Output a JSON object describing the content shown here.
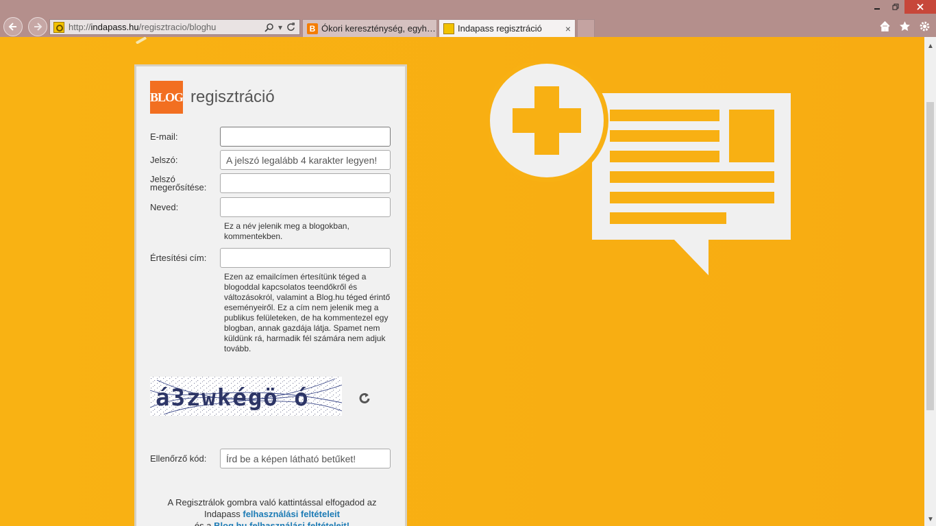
{
  "browser": {
    "url_proto": "http://",
    "url_host": "indapass.hu",
    "url_path": "/regisztracio/bloghu",
    "tabs": [
      {
        "label": "Ókori kereszténység, egyházat..."
      },
      {
        "label": "Indapass regisztráció",
        "close": "×"
      }
    ]
  },
  "form": {
    "logo_text": "BLOG",
    "title": "regisztráció",
    "email_label": "E-mail:",
    "email_value": "",
    "password_label": "Jelszó:",
    "password_placeholder": "A jelszó legalább 4 karakter legyen!",
    "password_confirm_label": "Jelszó megerősítése:",
    "name_label": "Neved:",
    "name_help": "Ez a név jelenik meg a blogokban, kommentekben.",
    "notify_label": "Értesítési cím:",
    "notify_help": "Ezen az emailcímen értesítünk téged a blogoddal kapcsolatos teendőkről és változásokról, valamint a Blog.hu téged érintő eseményeiről. Ez a cím nem jelenik meg a publikus felületeken, de ha kommentezel egy blogban, annak gazdája látja. Spamet nem küldünk rá, harmadik fél számára nem adjuk tovább.",
    "captcha_text": "á3zwkégö ó",
    "code_label": "Ellenőrző kód:",
    "code_placeholder": "Írd be a képen látható betűket!",
    "terms_prefix": "A Regisztrálok gombra való kattintással elfogadod az Indapass",
    "terms_link_1": "felhasználási feltételeit",
    "terms_middle": "és a",
    "terms_link_2": "Blog.hu felhasználási feltételeit!"
  },
  "colors": {
    "page_background": "#f8b013",
    "logo_orange": "#f26f21",
    "link_blue": "#1c7bb5"
  },
  "icons": [
    "back-arrow-icon",
    "forward-arrow-icon",
    "site-favicon-icon",
    "search-icon",
    "refresh-icon",
    "home-icon",
    "favorites-star-icon",
    "settings-gear-icon",
    "captcha-refresh-icon",
    "add-blog-post-illustration"
  ]
}
